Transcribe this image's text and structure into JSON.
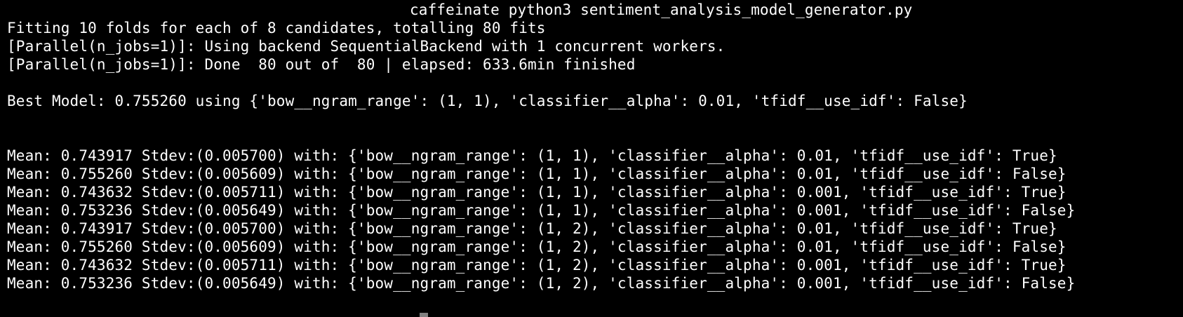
{
  "terminal": {
    "command": "caffeinate python3 sentiment_analysis_model_generator.py",
    "lines": [
      "Fitting 10 folds for each of 8 candidates, totalling 80 fits",
      "[Parallel(n_jobs=1)]: Using backend SequentialBackend with 1 concurrent workers.",
      "[Parallel(n_jobs=1)]: Done  80 out of  80 | elapsed: 633.6min finished",
      "",
      "Best Model: 0.755260 using {'bow__ngram_range': (1, 1), 'classifier__alpha': 0.01, 'tfidf__use_idf': False}",
      "",
      "",
      "Mean: 0.743917 Stdev:(0.005700) with: {'bow__ngram_range': (1, 1), 'classifier__alpha': 0.01, 'tfidf__use_idf': True}",
      "Mean: 0.755260 Stdev:(0.005609) with: {'bow__ngram_range': (1, 1), 'classifier__alpha': 0.01, 'tfidf__use_idf': False}",
      "Mean: 0.743632 Stdev:(0.005711) with: {'bow__ngram_range': (1, 1), 'classifier__alpha': 0.001, 'tfidf__use_idf': True}",
      "Mean: 0.753236 Stdev:(0.005649) with: {'bow__ngram_range': (1, 1), 'classifier__alpha': 0.001, 'tfidf__use_idf': False}",
      "Mean: 0.743917 Stdev:(0.005700) with: {'bow__ngram_range': (1, 2), 'classifier__alpha': 0.01, 'tfidf__use_idf': True}",
      "Mean: 0.755260 Stdev:(0.005609) with: {'bow__ngram_range': (1, 2), 'classifier__alpha': 0.01, 'tfidf__use_idf': False}",
      "Mean: 0.743632 Stdev:(0.005711) with: {'bow__ngram_range': (1, 2), 'classifier__alpha': 0.001, 'tfidf__use_idf': True}",
      "Mean: 0.753236 Stdev:(0.005649) with: {'bow__ngram_range': (1, 2), 'classifier__alpha': 0.001, 'tfidf__use_idf': False}"
    ],
    "colors": {
      "background": "#000000",
      "text": "#ffffff",
      "cursor": "#808080"
    }
  }
}
